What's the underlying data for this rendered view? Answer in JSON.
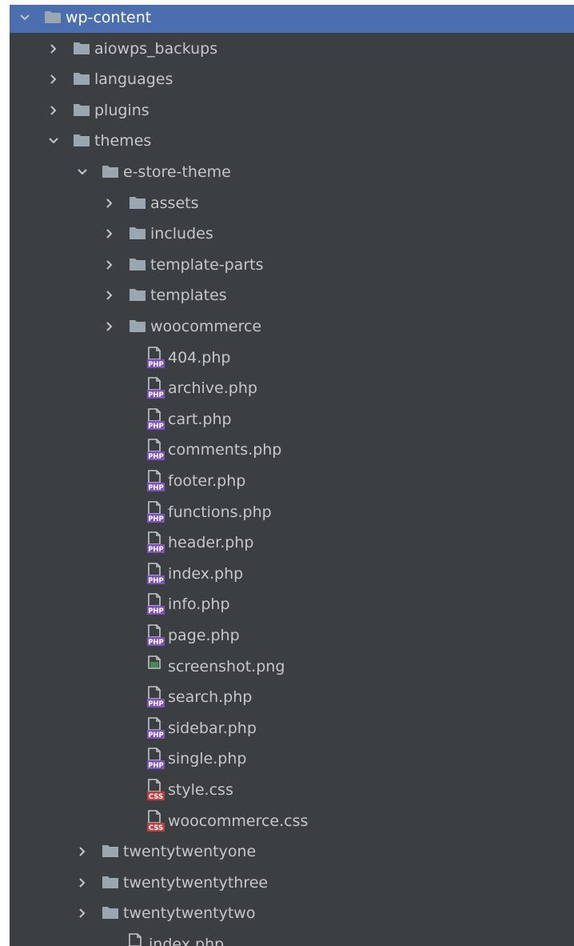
{
  "tree": {
    "root": {
      "label": "wp-content",
      "icon": "folder-icon",
      "expanded": true
    },
    "children": [
      {
        "label": "aiowps_backups",
        "icon": "folder-icon",
        "expanded": false
      },
      {
        "label": "languages",
        "icon": "folder-icon",
        "expanded": false
      },
      {
        "label": "plugins",
        "icon": "folder-icon",
        "expanded": false
      },
      {
        "label": "themes",
        "icon": "folder-icon",
        "expanded": true
      }
    ],
    "themes": {
      "estore": {
        "label": "e-store-theme",
        "icon": "folder-icon",
        "expanded": true
      },
      "estore_folders": [
        {
          "label": "assets",
          "icon": "folder-icon"
        },
        {
          "label": "includes",
          "icon": "folder-icon"
        },
        {
          "label": "template-parts",
          "icon": "folder-icon"
        },
        {
          "label": "templates",
          "icon": "folder-icon"
        },
        {
          "label": "woocommerce",
          "icon": "folder-icon"
        }
      ],
      "estore_files": [
        {
          "label": "404.php",
          "type": "php",
          "badge": "PHP"
        },
        {
          "label": "archive.php",
          "type": "php",
          "badge": "PHP"
        },
        {
          "label": "cart.php",
          "type": "php",
          "badge": "PHP"
        },
        {
          "label": "comments.php",
          "type": "php",
          "badge": "PHP"
        },
        {
          "label": "footer.php",
          "type": "php",
          "badge": "PHP"
        },
        {
          "label": "functions.php",
          "type": "php",
          "badge": "PHP"
        },
        {
          "label": "header.php",
          "type": "php",
          "badge": "PHP"
        },
        {
          "label": "index.php",
          "type": "php",
          "badge": "PHP"
        },
        {
          "label": "info.php",
          "type": "php",
          "badge": "PHP"
        },
        {
          "label": "page.php",
          "type": "php",
          "badge": "PHP"
        },
        {
          "label": "screenshot.png",
          "type": "png",
          "badge": ""
        },
        {
          "label": "search.php",
          "type": "php",
          "badge": "PHP"
        },
        {
          "label": "sidebar.php",
          "type": "php",
          "badge": "PHP"
        },
        {
          "label": "single.php",
          "type": "php",
          "badge": "PHP"
        },
        {
          "label": "style.css",
          "type": "css",
          "badge": "CSS"
        },
        {
          "label": "woocommerce.css",
          "type": "css",
          "badge": "CSS"
        }
      ],
      "other_themes": [
        {
          "label": "twentytwentyone",
          "icon": "folder-icon"
        },
        {
          "label": "twentytwentythree",
          "icon": "folder-icon"
        },
        {
          "label": "twentytwentytwo",
          "icon": "folder-icon"
        }
      ],
      "themes_files": [
        {
          "label": "index.php",
          "type": "php",
          "badge": "PHP"
        }
      ]
    }
  },
  "colors": {
    "panel_bg": "#3c3f41",
    "selection": "#4b6eaf",
    "text": "#c4c6c8",
    "folder": "#9aa7b0",
    "php_badge": "#7f52c2",
    "css_badge": "#c13f3f",
    "png_badge": "#3e8e5c"
  }
}
